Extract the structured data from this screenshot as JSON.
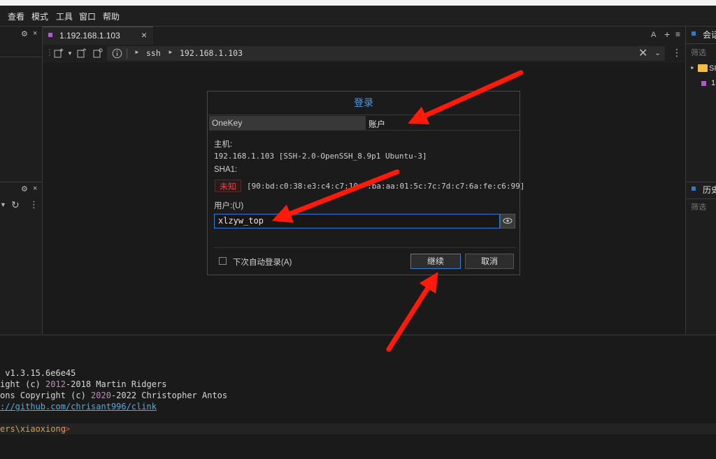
{
  "menu": [
    "查看",
    "模式",
    "工具",
    "窗口",
    "帮助"
  ],
  "left_panel": {
    "top_icons": [
      "⚙",
      "×"
    ],
    "bottom_icons": [
      "⚙",
      "×"
    ]
  },
  "tab": {
    "title": "1.192.168.1.103",
    "close": "×"
  },
  "tabbar_right": [
    "A",
    "+",
    "≡"
  ],
  "address": {
    "segments": [
      "ssh",
      "192.168.1.103"
    ]
  },
  "right_panel": {
    "session": {
      "title": "会话",
      "filter": "筛选",
      "folder": "SI",
      "item": "1"
    },
    "history": {
      "title": "历史",
      "filter": "筛选"
    }
  },
  "dialog": {
    "title": "登录",
    "tabs": [
      "OneKey",
      "账户"
    ],
    "host_label": "主机:",
    "host_value": "192.168.1.103 [SSH-2.0-OpenSSH_8.9p1 Ubuntu-3]",
    "sha_label": "SHA1:",
    "unknown_label": "未知",
    "fingerprint": "[90:bd:c0:38:e3:c4:c7:10:  :ba:aa:01:5c:7c:7d:c7:6a:fe:c6:99]",
    "user_label": "用户:(U)",
    "user_value": "xlzyw_top",
    "auto_login": "下次自动登录(A)",
    "continue": "继续",
    "cancel": "取消"
  },
  "terminal": {
    "line1": " v1.3.15.6e6e45",
    "line2_a": "ight (c) ",
    "line2_y1": "2012",
    "line2_b": "-2018 Martin Ridgers",
    "line3_a": "ons Copyright (c) ",
    "line3_y1": "2020",
    "line3_b": "-2022 Christopher Antos",
    "line4": "://github.com/chrisant996/clink",
    "prompt": "ers\\xiaoxiong",
    "prompt_sym": ">"
  },
  "colors": {
    "accent": "#4a9be0",
    "annotation_arrow": "#ff1a0a",
    "unknown_badge": "#e04545",
    "tab_marker": "#b655d8"
  }
}
